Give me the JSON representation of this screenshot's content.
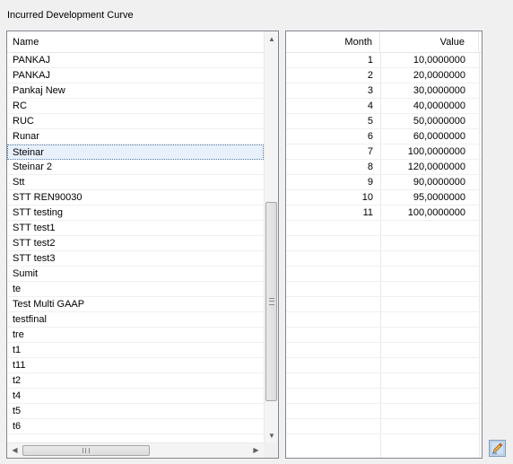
{
  "panel_title": "Incurred Development Curve",
  "name_list": {
    "header": "Name",
    "items": [
      "PANKAJ",
      "PANKAJ",
      "Pankaj New",
      "RC",
      "RUC",
      "Runar",
      "Steinar",
      "Steinar 2",
      "Stt",
      "STT REN90030",
      "STT testing",
      "STT test1",
      "STT test2",
      "STT test3",
      "Sumit",
      "te",
      "Test Multi GAAP",
      "testfinal",
      "tre",
      "t1",
      "t11",
      "t2",
      "t4",
      "t5",
      "t6"
    ],
    "selected": "Steinar"
  },
  "curve_grid": {
    "columns": {
      "month": "Month",
      "value": "Value"
    },
    "rows": [
      {
        "month": "1",
        "value": "10,0000000"
      },
      {
        "month": "2",
        "value": "20,0000000"
      },
      {
        "month": "3",
        "value": "30,0000000"
      },
      {
        "month": "4",
        "value": "40,0000000"
      },
      {
        "month": "5",
        "value": "50,0000000"
      },
      {
        "month": "6",
        "value": "60,0000000"
      },
      {
        "month": "7",
        "value": "100,0000000"
      },
      {
        "month": "8",
        "value": "120,0000000"
      },
      {
        "month": "9",
        "value": "90,0000000"
      },
      {
        "month": "10",
        "value": "95,0000000"
      },
      {
        "month": "11",
        "value": "100,0000000"
      }
    ],
    "empty_rows": 14
  },
  "icons": {
    "scroll_up": "scroll-up-arrow",
    "scroll_down": "scroll-down-arrow",
    "scroll_left": "scroll-left-arrow",
    "scroll_right": "scroll-right-arrow",
    "edit": "pencil-icon"
  }
}
